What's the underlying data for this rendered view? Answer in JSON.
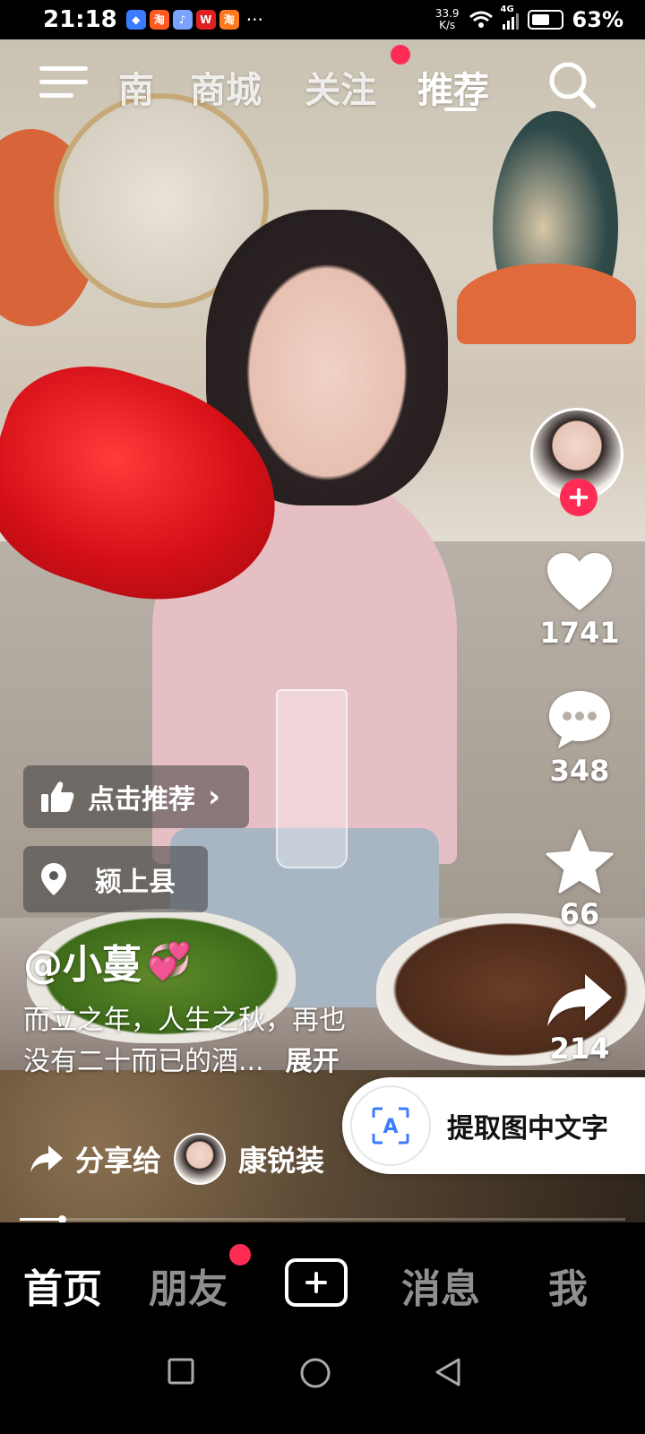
{
  "status": {
    "time": "21:18",
    "apps": [
      {
        "label": "◆",
        "bg": "#3b7bff"
      },
      {
        "label": "淘",
        "bg": "#ff5a1f"
      },
      {
        "label": "♪",
        "bg": "#7aa2ff"
      },
      {
        "label": "W",
        "bg": "#e02020"
      },
      {
        "label": "淘",
        "bg": "#ff7a1f"
      }
    ],
    "dots": "···",
    "net_speed_value": "33.9",
    "net_speed_unit": "K/s",
    "signal": "4G",
    "battery_percent": 63,
    "battery_text": "63%"
  },
  "top_nav": {
    "tabs": [
      "南",
      "商城",
      "关注",
      "推荐"
    ],
    "active_tab": "推荐",
    "follow_has_dot": true
  },
  "creator": {
    "username": "@小蔓",
    "username_emoji": "💞"
  },
  "actions": {
    "likes": "1741",
    "comments": "348",
    "favorites": "66",
    "shares": "214"
  },
  "overlay": {
    "recommend_label": "点击推荐",
    "location_label": "颍上县",
    "caption_line1": "而立之年，人生之秋，再也",
    "caption_line2": "没有二十而已的酒...",
    "expand_label": "展开",
    "share_label": "分享给",
    "share_target": "康锐装"
  },
  "extract_text": {
    "label": "提取图中文字",
    "icon_letter": "A"
  },
  "video_progress": 0.07,
  "bottom_tabs": {
    "home": "首页",
    "friends": "朋友",
    "messages": "消息",
    "me": "我"
  },
  "colors": {
    "accent": "#fe2c55"
  }
}
